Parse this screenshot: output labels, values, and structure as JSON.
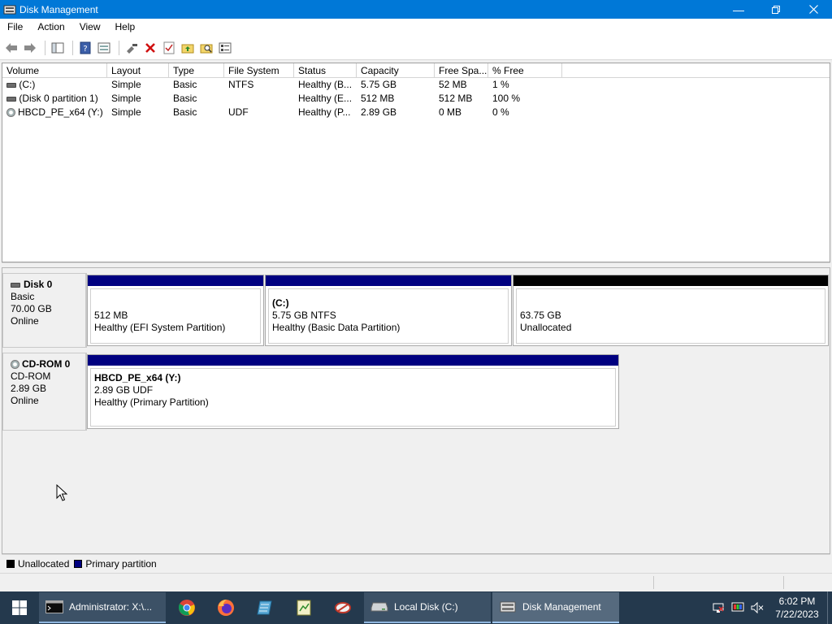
{
  "window": {
    "title": "Disk Management"
  },
  "menu": [
    "File",
    "Action",
    "View",
    "Help"
  ],
  "columns": [
    "Volume",
    "Layout",
    "Type",
    "File System",
    "Status",
    "Capacity",
    "Free Spa...",
    "% Free"
  ],
  "volumes": [
    {
      "icon": "drive-icon",
      "volume": " (C:)",
      "layout": "Simple",
      "type": "Basic",
      "fs": "NTFS",
      "status": "Healthy (B...",
      "capacity": "5.75 GB",
      "free": "52 MB",
      "pct": "1 %"
    },
    {
      "icon": "drive-icon",
      "volume": "(Disk 0 partition 1)",
      "layout": "Simple",
      "type": "Basic",
      "fs": "",
      "status": "Healthy (E...",
      "capacity": "512 MB",
      "free": "512 MB",
      "pct": "100 %"
    },
    {
      "icon": "cdrom-icon",
      "volume": "HBCD_PE_x64 (Y:)",
      "layout": "Simple",
      "type": "Basic",
      "fs": "UDF",
      "status": "Healthy (P...",
      "capacity": "2.89 GB",
      "free": "0 MB",
      "pct": "0 %"
    }
  ],
  "disks": [
    {
      "name": "Disk 0",
      "kind": "Basic",
      "size": "70.00 GB",
      "state": "Online",
      "partitions": [
        {
          "title": "",
          "line1": "512 MB",
          "line2": "Healthy (EFI System Partition)"
        },
        {
          "title": " (C:)",
          "line1": "5.75 GB NTFS",
          "line2": "Healthy (Basic Data Partition)"
        },
        {
          "title": "",
          "line1": "63.75 GB",
          "line2": "Unallocated"
        }
      ]
    },
    {
      "name": "CD-ROM 0",
      "kind": "CD-ROM",
      "size": "2.89 GB",
      "state": "Online",
      "partitions": [
        {
          "title": "HBCD_PE_x64  (Y:)",
          "line1": "2.89 GB UDF",
          "line2": "Healthy (Primary Partition)"
        }
      ]
    }
  ],
  "legend": {
    "unallocated": "Unallocated",
    "primary": "Primary partition"
  },
  "colors": {
    "primary": "#000080",
    "unallocated": "#000000",
    "titlebar": "#0078d7",
    "taskbar": "#24394d"
  },
  "taskbar": {
    "tasks": [
      {
        "label": "Administrator: X:\\...",
        "icon": "cmd-icon"
      },
      {
        "label": "Local Disk (C:)",
        "icon": "drive-icon"
      },
      {
        "label": "Disk Management",
        "icon": "disk-management-icon"
      }
    ],
    "pinned": [
      "chrome-icon",
      "firefox-icon",
      "notepad-icon",
      "editor-icon",
      "tool-icon"
    ],
    "clock": {
      "time": "6:02 PM",
      "date": "7/22/2023"
    }
  }
}
